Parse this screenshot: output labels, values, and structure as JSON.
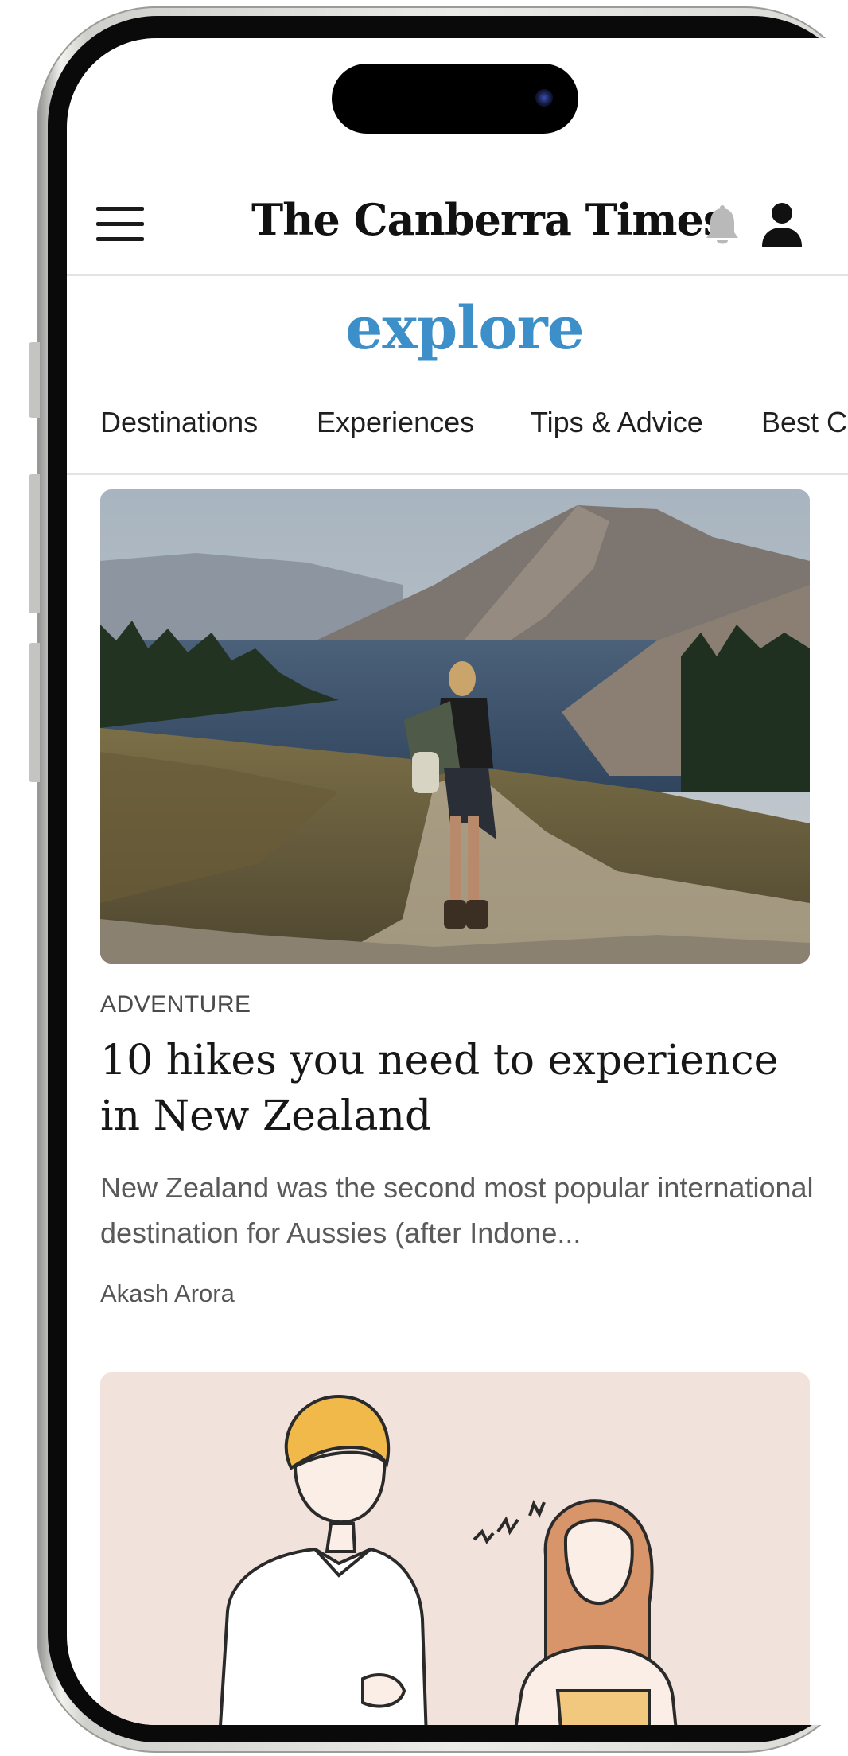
{
  "header": {
    "logo": "The Canberra Times",
    "menu_icon": "hamburger-menu-icon",
    "bell_icon": "bell-icon",
    "user_icon": "user-icon"
  },
  "section": {
    "title": "explore",
    "title_color": "#3d8fc9"
  },
  "tabs": [
    {
      "label": "Destinations"
    },
    {
      "label": "Experiences"
    },
    {
      "label": "Tips & Advice"
    },
    {
      "label": "Best C"
    }
  ],
  "articles": [
    {
      "category": "ADVENTURE",
      "title": "10 hikes you need to experience in New Zealand",
      "summary": "New Zealand was the second most popular international destination for Aussies (after Indone...",
      "author": "Akash Arora"
    }
  ]
}
